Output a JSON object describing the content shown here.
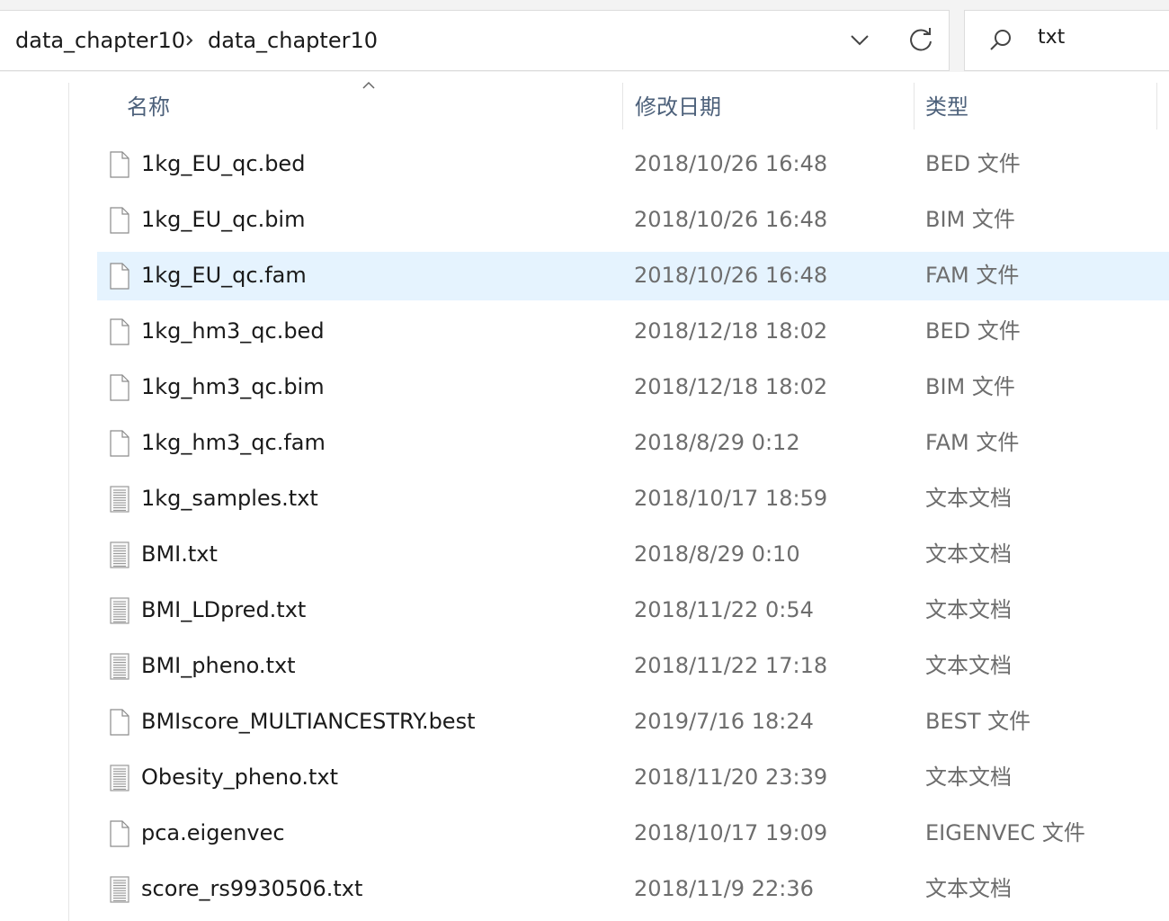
{
  "address_bar": {
    "breadcrumbs": [
      "data_chapter10",
      "data_chapter10"
    ]
  },
  "search": {
    "value": "txt"
  },
  "columns": {
    "name": "名称",
    "modified": "修改日期",
    "type": "类型"
  },
  "files": [
    {
      "name": "1kg_EU_qc.bed",
      "modified": "2018/10/26 16:48",
      "type": "BED 文件",
      "icon": "blank-file-icon",
      "selected": false
    },
    {
      "name": "1kg_EU_qc.bim",
      "modified": "2018/10/26 16:48",
      "type": "BIM 文件",
      "icon": "blank-file-icon",
      "selected": false
    },
    {
      "name": "1kg_EU_qc.fam",
      "modified": "2018/10/26 16:48",
      "type": "FAM 文件",
      "icon": "blank-file-icon",
      "selected": true
    },
    {
      "name": "1kg_hm3_qc.bed",
      "modified": "2018/12/18 18:02",
      "type": "BED 文件",
      "icon": "blank-file-icon",
      "selected": false
    },
    {
      "name": "1kg_hm3_qc.bim",
      "modified": "2018/12/18 18:02",
      "type": "BIM 文件",
      "icon": "blank-file-icon",
      "selected": false
    },
    {
      "name": "1kg_hm3_qc.fam",
      "modified": "2018/8/29 0:12",
      "type": "FAM 文件",
      "icon": "blank-file-icon",
      "selected": false
    },
    {
      "name": "1kg_samples.txt",
      "modified": "2018/10/17 18:59",
      "type": "文本文档",
      "icon": "text-file-icon",
      "selected": false
    },
    {
      "name": "BMI.txt",
      "modified": "2018/8/29 0:10",
      "type": "文本文档",
      "icon": "text-file-icon",
      "selected": false
    },
    {
      "name": "BMI_LDpred.txt",
      "modified": "2018/11/22 0:54",
      "type": "文本文档",
      "icon": "text-file-icon",
      "selected": false
    },
    {
      "name": "BMI_pheno.txt",
      "modified": "2018/11/22 17:18",
      "type": "文本文档",
      "icon": "text-file-icon",
      "selected": false
    },
    {
      "name": "BMIscore_MULTIANCESTRY.best",
      "modified": "2019/7/16 18:24",
      "type": "BEST 文件",
      "icon": "blank-file-icon",
      "selected": false
    },
    {
      "name": "Obesity_pheno.txt",
      "modified": "2018/11/20 23:39",
      "type": "文本文档",
      "icon": "text-file-icon",
      "selected": false
    },
    {
      "name": "pca.eigenvec",
      "modified": "2018/10/17 19:09",
      "type": "EIGENVEC 文件",
      "icon": "blank-file-icon",
      "selected": false
    },
    {
      "name": "score_rs9930506.txt",
      "modified": "2018/11/9 22:36",
      "type": "文本文档",
      "icon": "text-file-icon",
      "selected": false
    }
  ],
  "colors": {
    "selected_row": "#e5f3fe",
    "header_text": "#4c607a",
    "secondary_text": "#6d6d6d"
  }
}
